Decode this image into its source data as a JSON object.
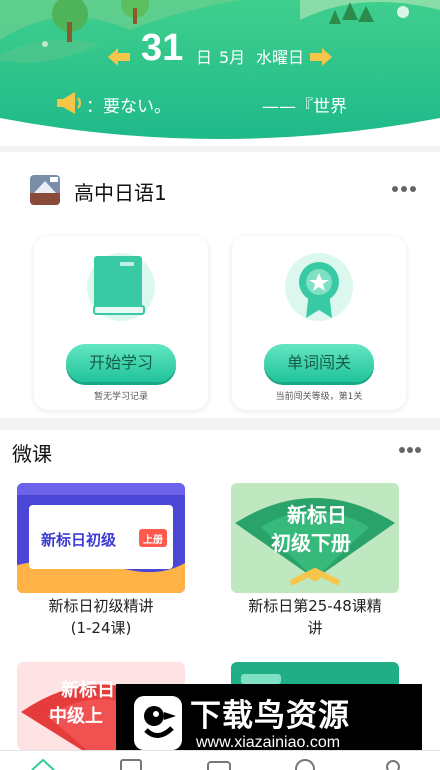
{
  "header": {
    "day": "31",
    "day_unit": "日",
    "month": "5月",
    "weekday": "水曜日",
    "quote_left": "：要ない。",
    "quote_right": "——『世界"
  },
  "course": {
    "title": "高中日语1"
  },
  "cards": [
    {
      "button": "开始学习",
      "note": "暂无学习记录"
    },
    {
      "button": "单词闯关",
      "note": "当前闯关等级，第1关"
    }
  ],
  "micro": {
    "title": "微课",
    "courses": [
      {
        "name_line1": "新标日初级精讲",
        "name_line2": "(1-24课)",
        "banner": "新标日初级",
        "banner_tag": "上册"
      },
      {
        "name_line1": "新标日第25-48课精",
        "name_line2": "讲",
        "banner": "新标日",
        "banner_sub": "初级下册"
      },
      {
        "banner": "新标日",
        "banner_sub": "中级上"
      }
    ]
  },
  "watermark": {
    "text": "下载鸟资源",
    "url": "www.xiazainiao.com"
  },
  "icons": {
    "speaker": "speaker-icon",
    "arrow_left": "arrow-left-icon",
    "arrow_right": "arrow-right-icon",
    "book": "book-icon",
    "medal": "medal-icon",
    "more": "more-dots-icon"
  },
  "colors": {
    "primary_green": "#2ecc9a",
    "button_text": "#145c48",
    "arrow_yellow": "#f6c64a"
  }
}
